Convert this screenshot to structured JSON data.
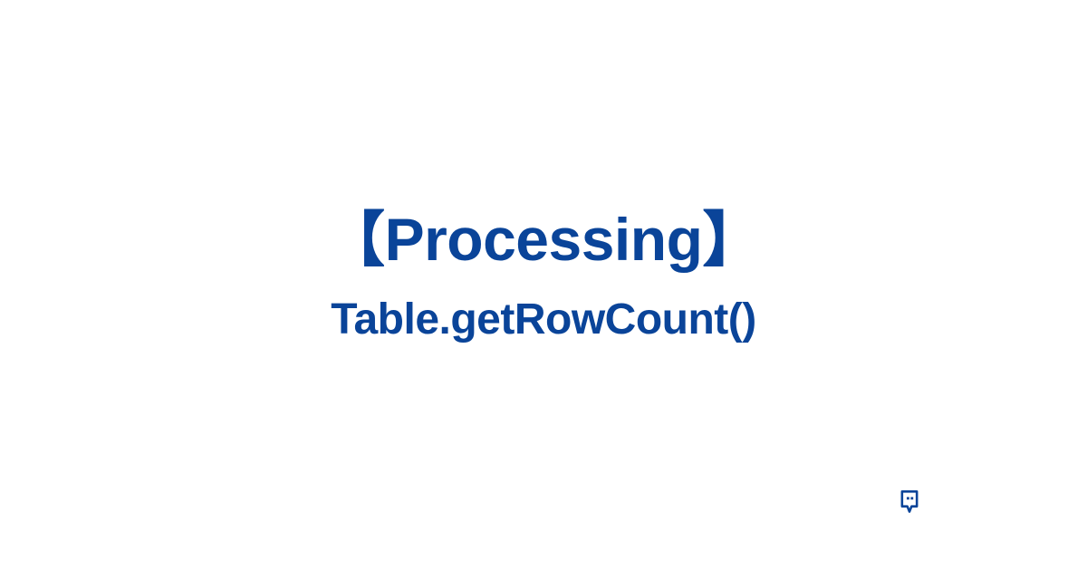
{
  "content": {
    "title": "【Processing】",
    "subtitle": "Table.getRowCount()"
  },
  "colors": {
    "text": "#0a4499",
    "background": "#ffffff"
  }
}
